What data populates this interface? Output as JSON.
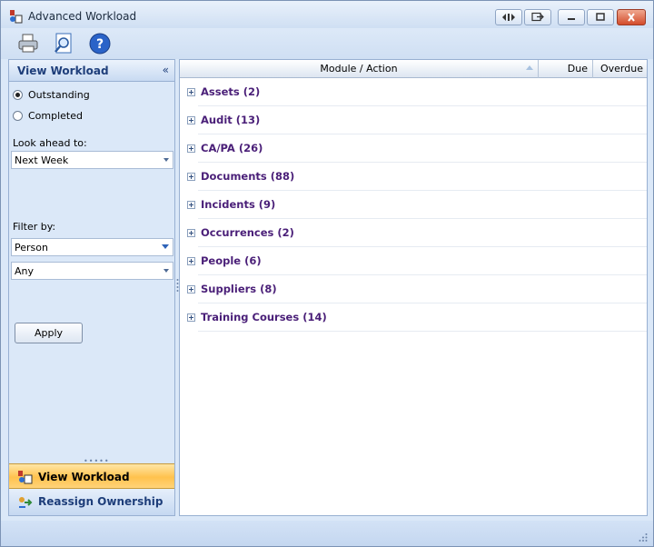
{
  "window": {
    "title": "Advanced Workload"
  },
  "toolbar": {
    "icons": [
      "printer-icon",
      "preview-icon",
      "help-icon"
    ]
  },
  "left_panel": {
    "header": "View Workload",
    "collapse_glyph": "«",
    "radios": [
      {
        "label": "Outstanding",
        "checked": true
      },
      {
        "label": "Completed",
        "checked": false
      }
    ],
    "look_ahead_label": "Look ahead to:",
    "look_ahead_value": "Next Week",
    "filter_label": "Filter by:",
    "filter_type_value": "Person",
    "filter_value": "Any",
    "apply_label": "Apply",
    "nav": [
      {
        "label": "View Workload",
        "active": true,
        "icon": "workload-icon"
      },
      {
        "label": "Reassign Ownership",
        "active": false,
        "icon": "reassign-icon"
      }
    ]
  },
  "grid": {
    "columns": [
      "Module / Action",
      "Due",
      "Overdue"
    ],
    "rows": [
      {
        "label": "Assets (2)"
      },
      {
        "label": "Audit (13)"
      },
      {
        "label": "CA/PA (26)"
      },
      {
        "label": "Documents (88)"
      },
      {
        "label": "Incidents (9)"
      },
      {
        "label": "Occurrences (2)"
      },
      {
        "label": "People (6)"
      },
      {
        "label": "Suppliers (8)"
      },
      {
        "label": "Training Courses (14)"
      }
    ]
  },
  "colors": {
    "row_text": "#4a1f78",
    "header_text": "#1e3e7a",
    "active_nav": "#ffc24e"
  }
}
